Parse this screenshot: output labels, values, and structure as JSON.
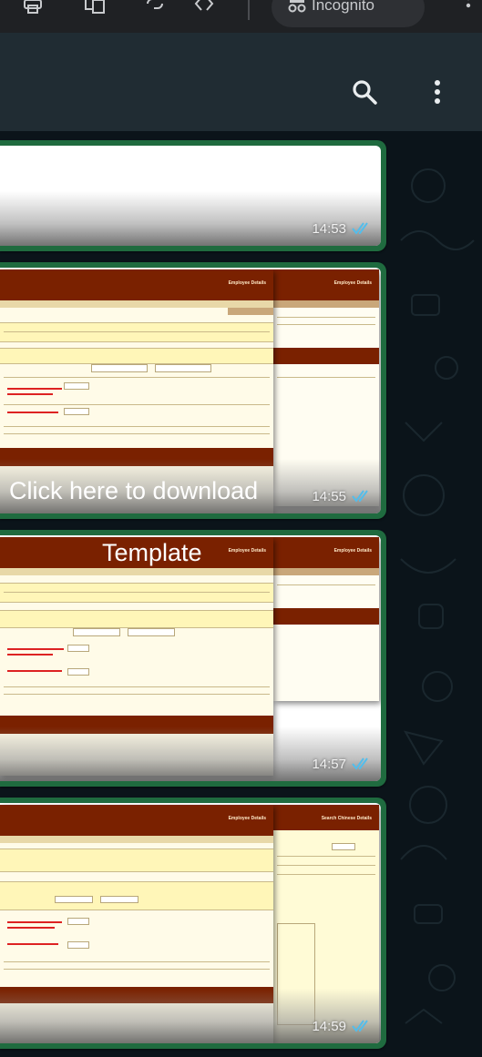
{
  "browser": {
    "incognito_label": "Incognito",
    "icons": [
      "print-icon",
      "screen-translate-icon",
      "link-icon",
      "code-icon",
      "incognito-icon",
      "overflow-menu-icon"
    ]
  },
  "header": {
    "icons": [
      "search-icon",
      "more-options-icon"
    ]
  },
  "messages": [
    {
      "time": "14:53",
      "status": "read"
    },
    {
      "time": "14:55",
      "status": "read",
      "doc_title": "Employee Details",
      "doc_title_back": "Employee Details"
    },
    {
      "time": "14:57",
      "status": "read",
      "doc_title": "Employee Details",
      "doc_title_back": "Employee Details"
    },
    {
      "time": "14:59",
      "status": "read",
      "doc_title": "Employee Details",
      "doc_title_back": "Search Chinese Details"
    }
  ],
  "overlay": {
    "download_text": "Click here to download",
    "template_text": "Template"
  },
  "colors": {
    "header_bg": "#202c33",
    "chat_bg": "#0b141a",
    "bubble_border": "#1f6b3f",
    "doc_header": "#7a2100",
    "read_ticks": "#53bdeb"
  }
}
